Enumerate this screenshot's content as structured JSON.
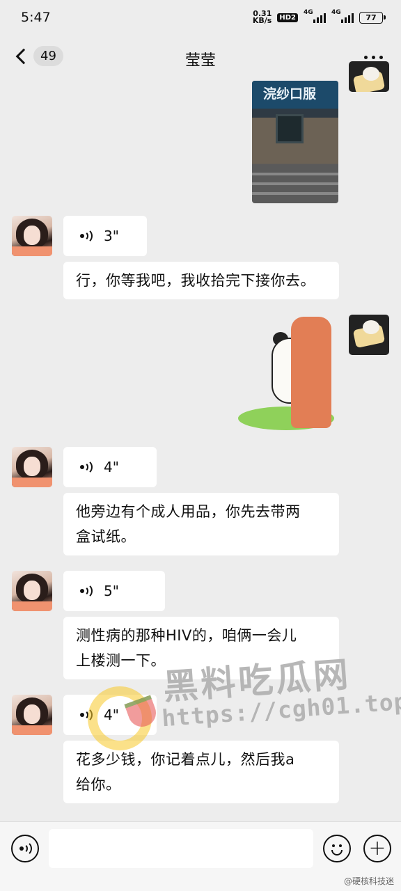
{
  "status_bar": {
    "time": "5:47",
    "net_speed_value": "0.31",
    "net_speed_unit": "KB/s",
    "hd_badge": "HD2",
    "signal_label_1": "4G",
    "signal_label_2": "4G",
    "battery_level": "77"
  },
  "header": {
    "unread_count": "49",
    "title": "莹莹"
  },
  "messages": [
    {
      "type": "image",
      "sender": "self",
      "sign_text": "浣纱口服"
    },
    {
      "type": "voice",
      "sender": "contact",
      "duration": "3\""
    },
    {
      "type": "text",
      "sender": "contact",
      "text": "行，你等我吧，我收拾完下接你去。"
    },
    {
      "type": "sticker",
      "sender": "self"
    },
    {
      "type": "voice",
      "sender": "contact",
      "duration": "4\""
    },
    {
      "type": "text",
      "sender": "contact",
      "lines": [
        "他旁边有个成人用品，你先去带两",
        "盒试纸。"
      ]
    },
    {
      "type": "voice",
      "sender": "contact",
      "duration": "5\""
    },
    {
      "type": "text",
      "sender": "contact",
      "lines": [
        "测性病的那种HIV的，咱俩一会儿",
        "上楼测一下。"
      ]
    },
    {
      "type": "voice",
      "sender": "contact",
      "duration": "4\""
    },
    {
      "type": "text",
      "sender": "contact",
      "lines": [
        "花多少钱，你记着点儿，然后我a",
        "给你。"
      ]
    }
  ],
  "watermark": {
    "title": "黑料吃瓜网",
    "url": "https://cgh01.top"
  },
  "input_bar": {
    "placeholder": ""
  },
  "credit": "@硬核科技迷",
  "icons": [
    "back-chevron-icon",
    "more-icon",
    "voice-icon",
    "emoji-icon",
    "plus-icon"
  ],
  "colors": {
    "background": "#ededed",
    "bubble": "#ffffff",
    "input_bar": "#f6f6f6"
  }
}
